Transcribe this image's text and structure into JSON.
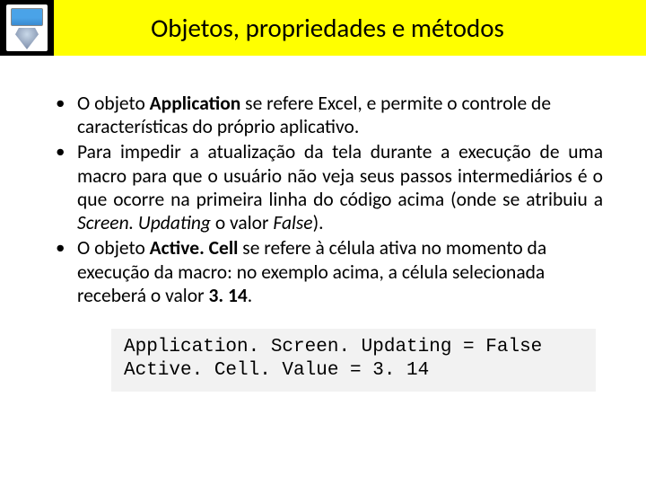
{
  "header": {
    "title": "Objetos, propriedades e métodos"
  },
  "bullets": [
    {
      "pre": "O objeto ",
      "b1": "Application",
      "post": " se refere Excel, e permite o controle de características do próprio aplicativo.",
      "justify": false
    },
    {
      "pre": "Para impedir a atualização da tela durante a execução de uma macro para que o usuário não veja seus passos intermediários é o que ocorre na primeira linha do código acima (onde se atribuiu a ",
      "i1": "Screen. Updating",
      "mid": " o valor ",
      "i2": "False",
      "post": ").",
      "justify": true
    },
    {
      "pre": "O objeto ",
      "b1": "Active. Cell",
      "mid": " se refere à célula ativa no momento da execução da macro: no exemplo acima, a célula selecionada receberá o valor ",
      "b2": "3. 14",
      "post": ".",
      "justify": false
    }
  ],
  "code": "Application. Screen. Updating = False\nActive. Cell. Value = 3. 14"
}
